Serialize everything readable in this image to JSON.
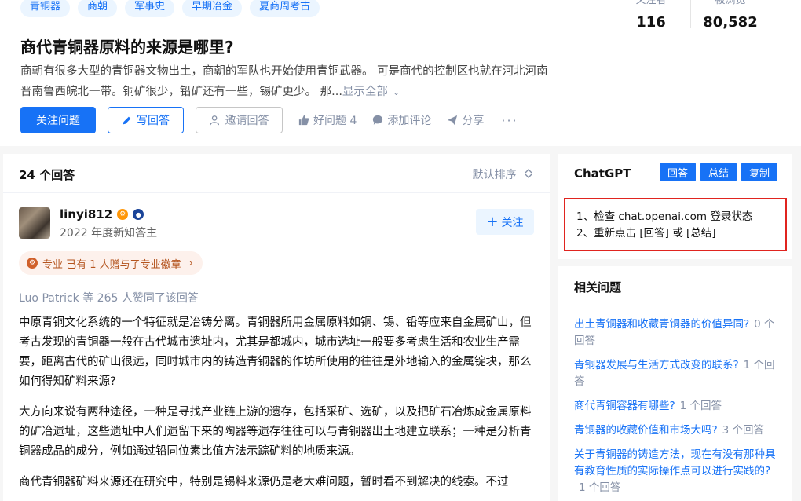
{
  "topics": [
    "青铜器",
    "商朝",
    "军事史",
    "早期冶金",
    "夏商周考古"
  ],
  "stats": [
    {
      "label": "关注者",
      "value": "116"
    },
    {
      "label": "被浏览",
      "value": "80,582"
    }
  ],
  "question": {
    "title": "商代青铜器原料的来源是哪里?",
    "desc": "商朝有很多大型的青铜器文物出土，商朝的军队也开始使用青铜武器。 可是商代的控制区也就在河北河南晋南鲁西皖北一带。铜矿很少，铅矿还有一些，锡矿更少。 那...",
    "show_all": "显示全部"
  },
  "actions": {
    "follow": "关注问题",
    "write": "写回答",
    "invite": "邀请回答",
    "good": "好问题 4",
    "comment": "添加评论",
    "share": "分享",
    "more": "···"
  },
  "answers": {
    "count": "24 个回答",
    "sort": "默认排序"
  },
  "answer": {
    "author": "linyi812",
    "subtitle": "2022 年度新知答主",
    "follow": "关注",
    "pro_chip": "专业 已有 1 人赠与了专业徽章",
    "likes": "Luo Patrick 等 265 人赞同了该回答",
    "paragraphs": [
      "中原青铜文化系统的一个特征就是冶铸分离。青铜器所用金属原料如铜、锡、铅等应来自金属矿山，但考古发现的青铜器一般在古代城市遗址内，尤其是都城内，城市选址一般要多考虑生活和农业生产需要，距离古代的矿山很远，同时城市内的铸造青铜器的作坊所使用的往往是外地输入的金属锭块，那么如何得知矿料来源?",
      "大方向来说有两种途径，一种是寻找产业链上游的遗存，包括采矿、选矿，以及把矿石冶炼成金属原料的矿冶遗址，这些遗址中人们遗留下来的陶器等遗存往往可以与青铜器出土地建立联系；一种是分析青铜器成品的成分，例如通过铅同位素比值方法示踪矿料的地质来源。",
      "商代青铜器矿料来源还在研究中，特别是锡料来源仍是老大难问题，暂时看不到解决的线索。不过"
    ]
  },
  "chatgpt": {
    "title": "ChatGPT",
    "buttons": [
      "回答",
      "总结",
      "复制"
    ],
    "line1_prefix": "1、检查 ",
    "line1_link": "chat.openai.com",
    "line1_suffix": " 登录状态",
    "line2": "2、重新点击 [回答] 或 [总结]"
  },
  "related": {
    "title": "相关问题",
    "items": [
      {
        "q": "出土青铜器和收藏青铜器的价值异同?",
        "count": "0 个回答"
      },
      {
        "q": "青铜器发展与生活方式改变的联系?",
        "count": "1 个回答"
      },
      {
        "q": "商代青铜容器有哪些?",
        "count": "1 个回答"
      },
      {
        "q": "青铜器的收藏价值和市场大吗?",
        "count": "3 个回答"
      },
      {
        "q": "关于青铜器的铸造方法，现在有没有那种具有教育性质的实际操作点可以进行实践的?",
        "count": "1 个回答"
      }
    ]
  },
  "colors": {
    "accent": "#1772f6",
    "highlight_border": "#e0241f"
  }
}
